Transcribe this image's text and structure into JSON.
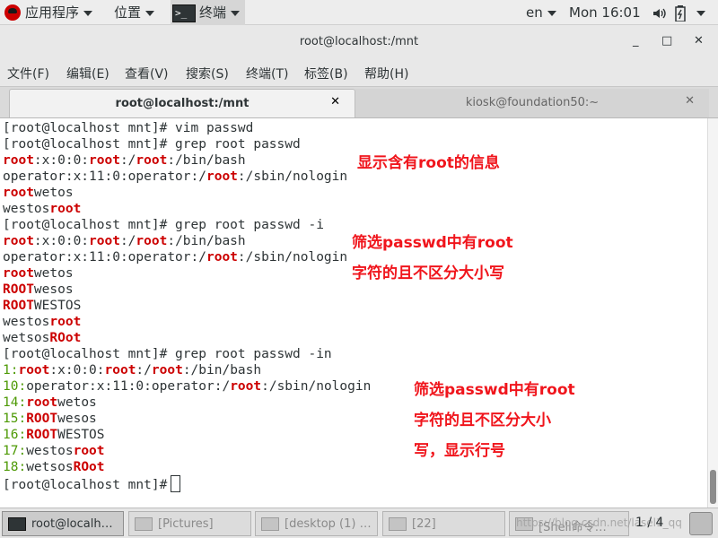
{
  "top_panel": {
    "apps_label": "应用程序",
    "places_label": "位置",
    "terminal_label": "终端",
    "language": "en",
    "clock": "Mon 16:01"
  },
  "window": {
    "title": "root@localhost:/mnt",
    "minimize": "_",
    "maximize": "□",
    "close": "✕"
  },
  "menubar": {
    "items": [
      "文件(F)",
      "编辑(E)",
      "查看(V)",
      "搜索(S)",
      "终端(T)",
      "标签(B)",
      "帮助(H)"
    ]
  },
  "tabs": [
    {
      "label": "root@localhost:/mnt",
      "active": true,
      "close": "✕"
    },
    {
      "label": "kiosk@foundation50:~",
      "active": false,
      "close": "✕"
    }
  ],
  "terminal": {
    "lines": [
      [
        {
          "t": "[root@localhost mnt]# vim passwd"
        }
      ],
      [
        {
          "t": "[root@localhost mnt]# grep root passwd"
        }
      ],
      [
        {
          "t": "root",
          "c": "r"
        },
        {
          "t": ":x:0:0:"
        },
        {
          "t": "root",
          "c": "r"
        },
        {
          "t": ":/"
        },
        {
          "t": "root",
          "c": "r"
        },
        {
          "t": ":/bin/bash"
        }
      ],
      [
        {
          "t": "operator:x:11:0:operator:/"
        },
        {
          "t": "root",
          "c": "r"
        },
        {
          "t": ":/sbin/nologin"
        }
      ],
      [
        {
          "t": "root",
          "c": "r"
        },
        {
          "t": "wetos"
        }
      ],
      [
        {
          "t": "westos"
        },
        {
          "t": "root",
          "c": "r"
        }
      ],
      [
        {
          "t": "[root@localhost mnt]# grep root passwd -i"
        }
      ],
      [
        {
          "t": "root",
          "c": "r"
        },
        {
          "t": ":x:0:0:"
        },
        {
          "t": "root",
          "c": "r"
        },
        {
          "t": ":/"
        },
        {
          "t": "root",
          "c": "r"
        },
        {
          "t": ":/bin/bash"
        }
      ],
      [
        {
          "t": "operator:x:11:0:operator:/"
        },
        {
          "t": "root",
          "c": "r"
        },
        {
          "t": ":/sbin/nologin"
        }
      ],
      [
        {
          "t": "root",
          "c": "r"
        },
        {
          "t": "wetos"
        }
      ],
      [
        {
          "t": "ROOT",
          "c": "r"
        },
        {
          "t": "wesos"
        }
      ],
      [
        {
          "t": "ROOT",
          "c": "r"
        },
        {
          "t": "WESTOS"
        }
      ],
      [
        {
          "t": "westos"
        },
        {
          "t": "root",
          "c": "r"
        }
      ],
      [
        {
          "t": "wetsos"
        },
        {
          "t": "ROot",
          "c": "r"
        }
      ],
      [
        {
          "t": "[root@localhost mnt]# grep root passwd -in"
        }
      ],
      [
        {
          "t": "1",
          "c": "g"
        },
        {
          "t": ":",
          "c": "g"
        },
        {
          "t": "root",
          "c": "r"
        },
        {
          "t": ":x:0:0:"
        },
        {
          "t": "root",
          "c": "r"
        },
        {
          "t": ":/"
        },
        {
          "t": "root",
          "c": "r"
        },
        {
          "t": ":/bin/bash"
        }
      ],
      [
        {
          "t": "10",
          "c": "g"
        },
        {
          "t": ":",
          "c": "g"
        },
        {
          "t": "operator:x:11:0:operator:/"
        },
        {
          "t": "root",
          "c": "r"
        },
        {
          "t": ":/sbin/nologin"
        }
      ],
      [
        {
          "t": "14",
          "c": "g"
        },
        {
          "t": ":",
          "c": "g"
        },
        {
          "t": "root",
          "c": "r"
        },
        {
          "t": "wetos"
        }
      ],
      [
        {
          "t": "15",
          "c": "g"
        },
        {
          "t": ":",
          "c": "g"
        },
        {
          "t": "ROOT",
          "c": "r"
        },
        {
          "t": "wesos"
        }
      ],
      [
        {
          "t": "16",
          "c": "g"
        },
        {
          "t": ":",
          "c": "g"
        },
        {
          "t": "ROOT",
          "c": "r"
        },
        {
          "t": "WESTOS"
        }
      ],
      [
        {
          "t": "17",
          "c": "g"
        },
        {
          "t": ":",
          "c": "g"
        },
        {
          "t": "westos"
        },
        {
          "t": "root",
          "c": "r"
        }
      ],
      [
        {
          "t": "18",
          "c": "g"
        },
        {
          "t": ":",
          "c": "g"
        },
        {
          "t": "wetsos"
        },
        {
          "t": "ROot",
          "c": "r"
        }
      ],
      [
        {
          "t": "[root@localhost mnt]#"
        },
        {
          "cursor": true
        }
      ]
    ]
  },
  "annotations": {
    "a1": "显示含有root的信息",
    "a2_line1": "筛选passwd中有root",
    "a2_line2": "字符的且不区分大小写",
    "a3_line1": "筛选passwd中有root",
    "a3_line2": "字符的且不区分大小",
    "a3_line3": "写，显示行号"
  },
  "taskbar": {
    "tasks": [
      "root@localh…",
      "[Pictures]",
      "[desktop (1) …",
      "[22]",
      "[Shell命令…"
    ],
    "workspace": "1 / 4",
    "watermark": "https://blog.csdn.net/lasel1_qq"
  },
  "colors": {
    "match": "#cc0000",
    "line_number": "#4e9a06",
    "annotation": "#f0151c",
    "text": "#2e3436"
  }
}
